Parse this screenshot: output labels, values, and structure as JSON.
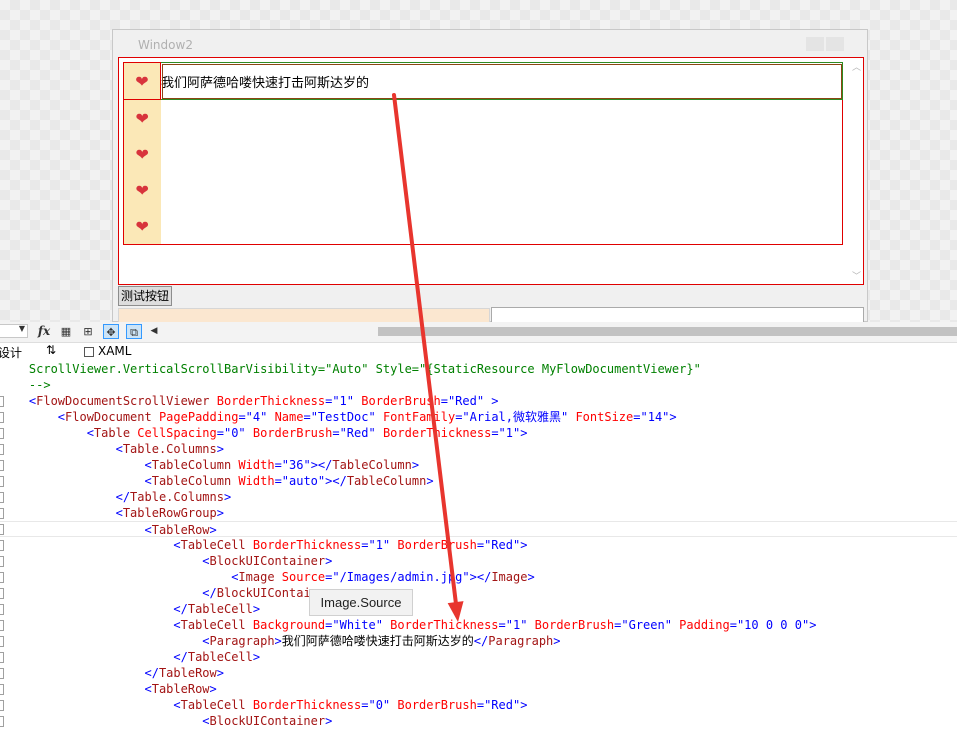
{
  "window": {
    "title": "Window2"
  },
  "flow_document": {
    "rows": [
      {
        "icon": "heart-icon",
        "text": "我们阿萨德哈喽快速打击阿斯达岁的"
      },
      {
        "icon": "heart-icon",
        "text": ""
      },
      {
        "icon": "heart-icon",
        "text": ""
      },
      {
        "icon": "heart-icon",
        "text": ""
      },
      {
        "icon": "heart-icon",
        "text": ""
      }
    ]
  },
  "test_button": {
    "label": "测试按钮"
  },
  "toolbar": {
    "fx": "fx",
    "icons": [
      "grid-icon",
      "layout-icon",
      "snap-icon",
      "source-icon"
    ]
  },
  "tabs": {
    "design": "设计",
    "swap": "⇅",
    "xaml": "XAML"
  },
  "tooltip": {
    "text": "Image.Source"
  },
  "code": {
    "lines": [
      [
        [
          "cmt",
          "    ScrollViewer.VerticalScrollBarVisibility=\"Auto\" Style=\"{StaticResource MyFlowDocumentViewer}\""
        ]
      ],
      [
        [
          "cmt",
          "    -->"
        ]
      ],
      [
        [
          "br",
          "    <"
        ],
        [
          "tag",
          "FlowDocumentScrollViewer"
        ],
        [
          "attr",
          " BorderThickness"
        ],
        [
          "br",
          "=\"1\""
        ],
        [
          "attr",
          " BorderBrush"
        ],
        [
          "br",
          "=\"Red\""
        ],
        [
          "br",
          " >"
        ]
      ],
      [
        [
          "br",
          "        <"
        ],
        [
          "tag",
          "FlowDocument"
        ],
        [
          "attr",
          " PagePadding"
        ],
        [
          "br",
          "=\"4\""
        ],
        [
          "attr",
          " Name"
        ],
        [
          "br",
          "=\"TestDoc\""
        ],
        [
          "attr",
          " FontFamily"
        ],
        [
          "br",
          "=\"Arial,微软雅黑\""
        ],
        [
          "attr",
          " FontSize"
        ],
        [
          "br",
          "=\"14\""
        ],
        [
          "br",
          ">"
        ]
      ],
      [
        [
          "br",
          "            <"
        ],
        [
          "tag",
          "Table"
        ],
        [
          "attr",
          " CellSpacing"
        ],
        [
          "br",
          "=\"0\""
        ],
        [
          "attr",
          " BorderBrush"
        ],
        [
          "br",
          "=\"Red\""
        ],
        [
          "attr",
          " BorderThickness"
        ],
        [
          "br",
          "=\"1\""
        ],
        [
          "br",
          ">"
        ]
      ],
      [
        [
          "br",
          "                <"
        ],
        [
          "tag",
          "Table.Columns"
        ],
        [
          "br",
          ">"
        ]
      ],
      [
        [
          "br",
          "                    <"
        ],
        [
          "tag",
          "TableColumn"
        ],
        [
          "attr",
          " Width"
        ],
        [
          "br",
          "=\"36\""
        ],
        [
          "br",
          "></"
        ],
        [
          "tag",
          "TableColumn"
        ],
        [
          "br",
          ">"
        ]
      ],
      [
        [
          "br",
          "                    <"
        ],
        [
          "tag",
          "TableColumn"
        ],
        [
          "attr",
          " Width"
        ],
        [
          "br",
          "=\"auto\""
        ],
        [
          "br",
          "></"
        ],
        [
          "tag",
          "TableColumn"
        ],
        [
          "br",
          ">"
        ]
      ],
      [
        [
          "br",
          "                </"
        ],
        [
          "tag",
          "Table.Columns"
        ],
        [
          "br",
          ">"
        ]
      ],
      [
        [
          "br",
          "                <"
        ],
        [
          "tag",
          "TableRowGroup"
        ],
        [
          "br",
          ">"
        ]
      ],
      [
        [
          "br",
          "                    <"
        ],
        [
          "tag",
          "TableRow"
        ],
        [
          "br",
          ">"
        ]
      ],
      [
        [
          "br",
          "                        <"
        ],
        [
          "tag",
          "TableCell"
        ],
        [
          "attr",
          " BorderThickness"
        ],
        [
          "br",
          "=\"1\""
        ],
        [
          "attr",
          " BorderBrush"
        ],
        [
          "br",
          "=\"Red\""
        ],
        [
          "br",
          ">"
        ]
      ],
      [
        [
          "br",
          "                            <"
        ],
        [
          "tag",
          "BlockUIContainer"
        ],
        [
          "br",
          ">"
        ]
      ],
      [
        [
          "br",
          "                                <"
        ],
        [
          "tag",
          "Image"
        ],
        [
          "attr",
          " Source"
        ],
        [
          "br",
          "=\"/Images/admin.jpg\""
        ],
        [
          "br",
          "></"
        ],
        [
          "tag",
          "Image"
        ],
        [
          "br",
          ">"
        ]
      ],
      [
        [
          "br",
          "                            </"
        ],
        [
          "tag",
          "BlockUIContainer"
        ],
        [
          "br",
          ">"
        ]
      ],
      [
        [
          "br",
          "                        </"
        ],
        [
          "tag",
          "TableCell"
        ],
        [
          "br",
          ">"
        ]
      ],
      [
        [
          "br",
          "                        <"
        ],
        [
          "tag",
          "TableCell"
        ],
        [
          "attr",
          " Background"
        ],
        [
          "br",
          "=\"White\""
        ],
        [
          "attr",
          " BorderThickness"
        ],
        [
          "br",
          "=\"1\""
        ],
        [
          "attr",
          " BorderBrush"
        ],
        [
          "br",
          "=\"Green\""
        ],
        [
          "attr",
          " Padding"
        ],
        [
          "br",
          "=\"10 0 0 0\""
        ],
        [
          "br",
          ">"
        ]
      ],
      [
        [
          "br",
          "                            <"
        ],
        [
          "tag",
          "Paragraph"
        ],
        [
          "br",
          ">"
        ],
        [
          "txt",
          "我们阿萨德哈喽快速打击阿斯达岁的"
        ],
        [
          "br",
          "</"
        ],
        [
          "tag",
          "Paragraph"
        ],
        [
          "br",
          ">"
        ]
      ],
      [
        [
          "br",
          "                        </"
        ],
        [
          "tag",
          "TableCell"
        ],
        [
          "br",
          ">"
        ]
      ],
      [
        [
          "br",
          "                    </"
        ],
        [
          "tag",
          "TableRow"
        ],
        [
          "br",
          ">"
        ]
      ],
      [
        [
          "br",
          "                    <"
        ],
        [
          "tag",
          "TableRow"
        ],
        [
          "br",
          ">"
        ]
      ],
      [
        [
          "br",
          "                        <"
        ],
        [
          "tag",
          "TableCell"
        ],
        [
          "attr",
          " BorderThickness"
        ],
        [
          "br",
          "=\"0\""
        ],
        [
          "attr",
          " BorderBrush"
        ],
        [
          "br",
          "=\"Red\""
        ],
        [
          "br",
          ">"
        ]
      ],
      [
        [
          "br",
          "                            <"
        ],
        [
          "tag",
          "BlockUIContainer"
        ],
        [
          "br",
          ">"
        ]
      ]
    ]
  },
  "colors": {
    "annotation_arrow": "#e8352e",
    "border_red": "#e00000",
    "cell_green": "#2e8b22",
    "icon_cell_bg": "#fbe8b7"
  }
}
